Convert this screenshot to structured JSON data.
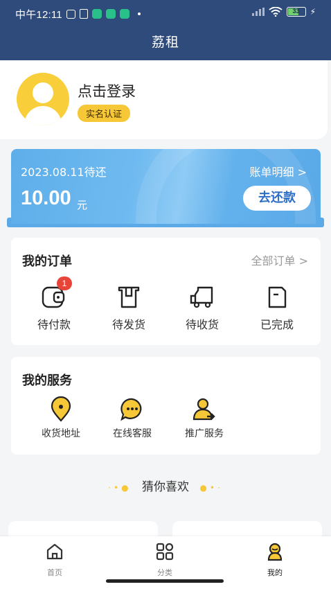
{
  "status_bar": {
    "time": "中午12:11",
    "battery": "33"
  },
  "header": {
    "title": "荔租"
  },
  "profile": {
    "login_text": "点击登录",
    "verify_label": "实名认证"
  },
  "bill": {
    "due_text": "2023.08.11待还",
    "detail_link": "账单明细 >",
    "amount": "10.00",
    "unit": "元",
    "repay_button": "去还款"
  },
  "orders": {
    "title": "我的订单",
    "all_link": "全部订单 >",
    "items": [
      {
        "label": "待付款",
        "icon": "wallet-icon",
        "badge": "1"
      },
      {
        "label": "待发货",
        "icon": "box-icon"
      },
      {
        "label": "待收货",
        "icon": "truck-icon"
      },
      {
        "label": "已完成",
        "icon": "doc-done-icon"
      }
    ]
  },
  "services": {
    "title": "我的服务",
    "items": [
      {
        "label": "收货地址",
        "icon": "location-icon"
      },
      {
        "label": "在线客服",
        "icon": "chat-icon"
      },
      {
        "label": "推广服务",
        "icon": "promote-user-icon"
      }
    ]
  },
  "recommend": {
    "title": "猜你喜欢"
  },
  "tabbar": {
    "items": [
      {
        "label": "首页",
        "icon": "home-icon"
      },
      {
        "label": "分类",
        "icon": "grid-icon"
      },
      {
        "label": "我的",
        "icon": "profile-icon",
        "active": true
      }
    ]
  },
  "colors": {
    "header_bg": "#2f4b7c",
    "accent_yellow": "#f6c736",
    "bill_blue": "#5eaeea",
    "badge_red": "#e8453a"
  }
}
